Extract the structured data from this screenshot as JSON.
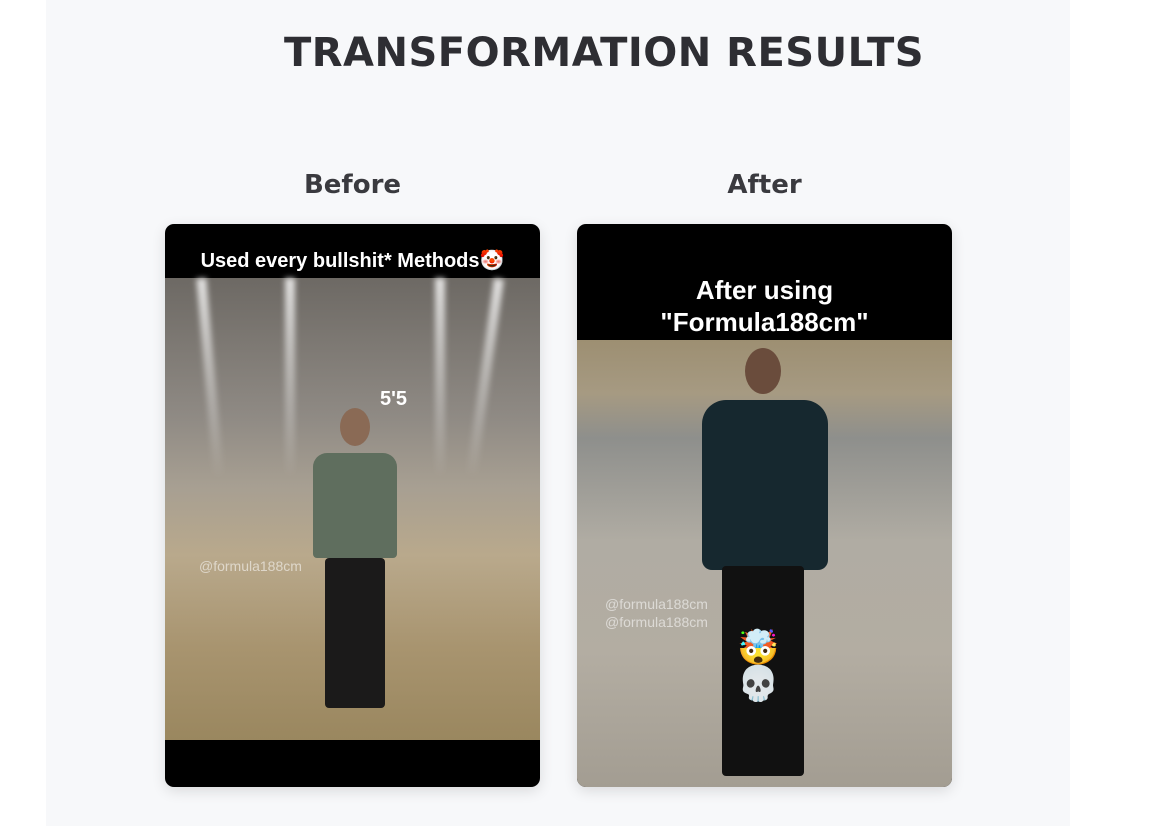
{
  "page": {
    "title": "TRANSFORMATION RESULTS"
  },
  "before": {
    "label": "Before",
    "caption": "Used every bullshit* Methods🤡",
    "height_tag": "5'5",
    "watermark": "@formula188cm"
  },
  "after": {
    "label": "After",
    "caption_line1": "After using",
    "caption_line2": "\"Formula188cm\"",
    "watermark1": "@formula188cm",
    "watermark2": "@formula188cm",
    "emoji": "🤯💀"
  }
}
